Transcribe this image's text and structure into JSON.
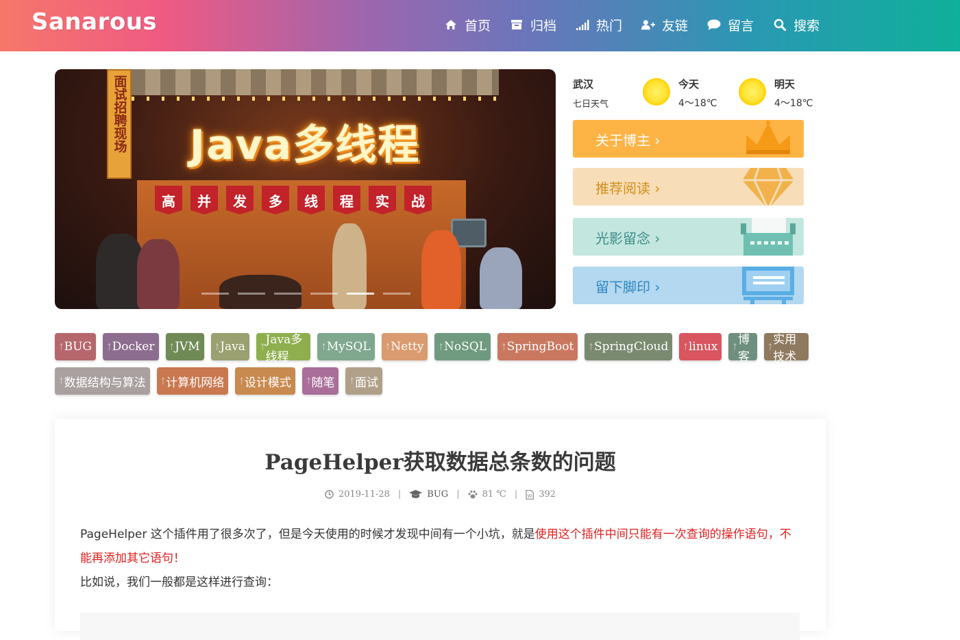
{
  "header": {
    "logo": "Sanarous",
    "nav": [
      {
        "label": "首页",
        "icon": "home-icon"
      },
      {
        "label": "归档",
        "icon": "archive-icon"
      },
      {
        "label": "热门",
        "icon": "signal-icon"
      },
      {
        "label": "友链",
        "icon": "user-plus-icon"
      },
      {
        "label": "留言",
        "icon": "comment-icon"
      },
      {
        "label": "搜索",
        "icon": "search-icon"
      }
    ]
  },
  "banner": {
    "sign": "面试招聘现场",
    "title": "Java多线程",
    "subtitle_chars": [
      "高",
      "并",
      "发",
      "多",
      "线",
      "程",
      "实",
      "战"
    ],
    "slides": 6,
    "active_slide": 5
  },
  "weather": {
    "city": "武汉",
    "subtitle": "七日天气",
    "today": {
      "label": "今天",
      "temp": "4～18℃",
      "icon": "sun-icon"
    },
    "tomorrow": {
      "label": "明天",
      "temp": "4～18℃",
      "icon": "sun-icon"
    }
  },
  "cards": [
    {
      "label": "关于博主 ›",
      "icon": "crown-icon",
      "color": "#feb445"
    },
    {
      "label": "推荐阅读 ›",
      "icon": "diamond-icon",
      "color": "#f7deb8"
    },
    {
      "label": "光影留念 ›",
      "icon": "typewriter-icon",
      "color": "#c3e6df"
    },
    {
      "label": "留下脚印 ›",
      "icon": "monitor-icon",
      "color": "#b3d8ef"
    }
  ],
  "tags_row1": [
    {
      "label": "BUG",
      "color": "#b5676b"
    },
    {
      "label": "Docker",
      "color": "#8d6d8f"
    },
    {
      "label": "JVM",
      "color": "#6f8a55"
    },
    {
      "label": "Java",
      "color": "#9aa06f"
    },
    {
      "label": "Java多线程",
      "color": "#8faf4f"
    },
    {
      "label": "MySQL",
      "color": "#7fa88f"
    },
    {
      "label": "Netty",
      "color": "#d99b6f"
    },
    {
      "label": "NoSQL",
      "color": "#6f9a7f"
    },
    {
      "label": "SpringBoot",
      "color": "#c9785f"
    },
    {
      "label": "SpringCloud",
      "color": "#7a8a70"
    },
    {
      "label": "linux",
      "color": "#d9555f"
    },
    {
      "label": "博客",
      "color": "#6f8f7f"
    },
    {
      "label": "实用技术",
      "color": "#8f7a5f"
    }
  ],
  "tags_row2": [
    {
      "label": "数据结构与算法",
      "color": "#aaa0a0"
    },
    {
      "label": "计算机网络",
      "color": "#c9784f"
    },
    {
      "label": "设计模式",
      "color": "#c98a4f"
    },
    {
      "label": "随笔",
      "color": "#a96f9a"
    },
    {
      "label": "面试",
      "color": "#b0a08a"
    }
  ],
  "article": {
    "title": "PageHelper获取数据总条数的问题",
    "date": "2019-11-28",
    "category": "BUG",
    "heat": "81 ℃",
    "words": "392",
    "para1_normal": "PageHelper 这个插件用了很多次了，但是今天使用的时候才发现中间有一个小坑，就是",
    "para1_red": "使用这个插件中间只能有一次查询的操作语句，不能再添加其它语句！",
    "para2": "比如说，我们一般都是这样进行查询："
  }
}
